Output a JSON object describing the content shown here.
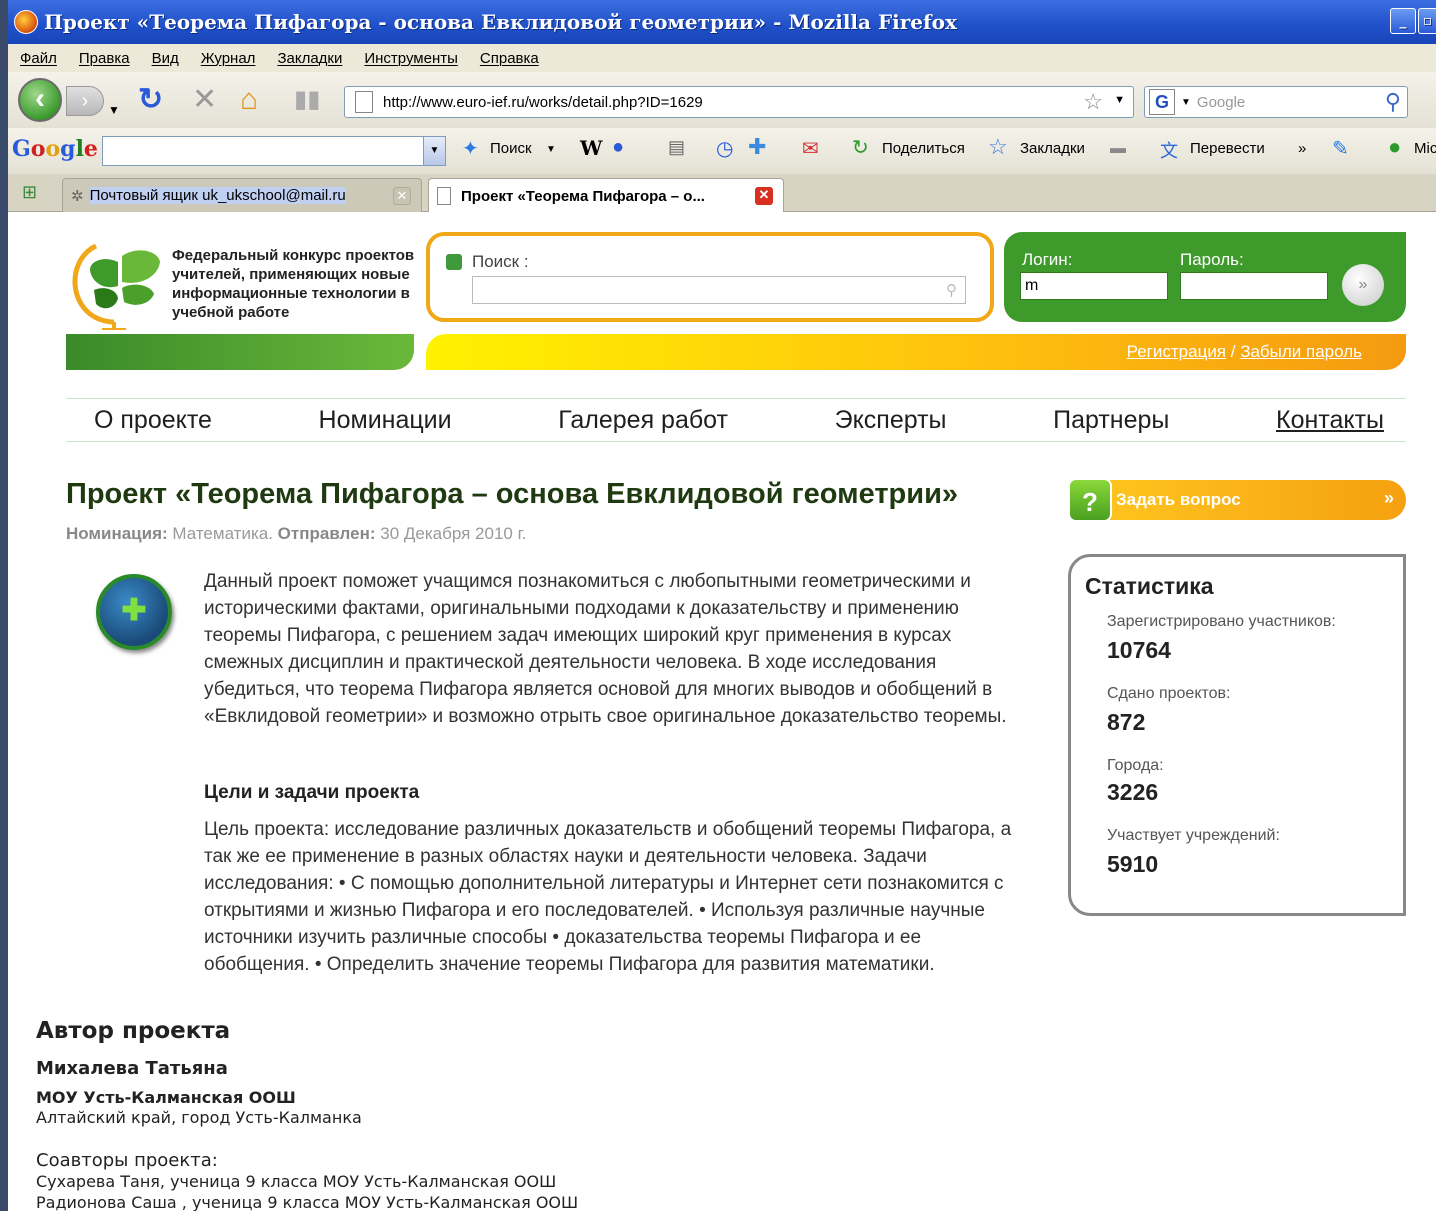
{
  "window": {
    "title": "Проект «Теорема Пифагора - основа Евклидовой геометрии» - Mozilla Firefox"
  },
  "menu": [
    "Файл",
    "Правка",
    "Вид",
    "Журнал",
    "Закладки",
    "Инструменты",
    "Справка"
  ],
  "navigation": {
    "url": "http://www.euro-ief.ru/works/detail.php?ID=1629",
    "search_placeholder": "Google"
  },
  "google_toolbar": {
    "search": "Поиск",
    "share": "Поделиться",
    "bookmarks": "Закладки",
    "translate": "Перевести",
    "more": "»",
    "trailing": "Mic"
  },
  "tabs": [
    {
      "label": "Почтовый ящик uk_ukschool@mail.ru"
    },
    {
      "label": "Проект «Теорема Пифагора – о..."
    }
  ],
  "site": {
    "title": "Федеральный конкурс проектов учителей, применяющих новые информационные технологии в учебной работе",
    "search_label": "Поиск :",
    "login_label": "Логин:",
    "password_label": "Пароль:",
    "login_value": "m",
    "register_link": "Регистрация",
    "separator": " / ",
    "forgot_link": "Забыли пароль",
    "go_button": "»"
  },
  "nav": [
    "О проекте",
    "Номинации",
    "Галерея работ",
    "Эксперты",
    "Партнеры",
    "Контакты"
  ],
  "project": {
    "title": "Проект «Теорема Пифагора – основа Евклидовой геометрии»",
    "nomination_label": "Номинация:",
    "nomination_value": "Математика.",
    "sent_label": "Отправлен:",
    "sent_value": "30 Декабря 2010 г.",
    "description": "Данный проект поможет учащимся познакомиться с любопытными геометрическими и историческими фактами, оригинальными подходами к доказательству и применению теоремы Пифагора, с решением задач имеющих широкий круг применения в курсах смежных дисциплин и практической деятельности человека. В ходе исследования убедиться, что теорема Пифагора является основой для многих выводов и обобщений в «Евклидовой геометрии» и возможно отрыть свое оригинальное доказательство теоремы.",
    "goals_title": "Цели и задачи проекта",
    "goals": "Цель проекта: исследование различных доказательств и обобщений теоремы Пифагора, а так же ее применение в разных областях науки и деятельности человека. Задачи исследования: • С помощью дополнительной литературы и Интернет сети познакомится с открытиями и жизнью Пифагора и его последователей. • Используя различные научные источники изучить различные способы • доказательства теоремы Пифагора и ее обобщения. • Определить значение теоремы Пифагора для развития математики."
  },
  "ask_button": "Задать вопрос",
  "ask_arrow": "»",
  "stats": {
    "title": "Статистика",
    "items": [
      {
        "label": "Зарегистрировано участников:",
        "value": "10764"
      },
      {
        "label": "Сдано проектов:",
        "value": "872"
      },
      {
        "label": "Города:",
        "value": "3226"
      },
      {
        "label": "Участвует учреждений:",
        "value": "5910"
      }
    ]
  },
  "author": {
    "heading": "Автор проекта",
    "name": "Михалева Татьяна",
    "school": "МОУ Усть-Калманская ООШ",
    "location": "Алтайский край, город Усть-Калманка",
    "coauthors_label": "Соавторы проекта:",
    "coauthors": [
      "Сухарева Таня, ученица 9 класса МОУ Усть-Калманская ООШ",
      "Радионова Саша , ученица 9 класса МОУ Усть-Калманская ООШ"
    ]
  },
  "colors": {
    "brand_green": "#3f9a2c",
    "brand_orange": "#f0a818",
    "titlebar_blue": "#1f50c9"
  }
}
